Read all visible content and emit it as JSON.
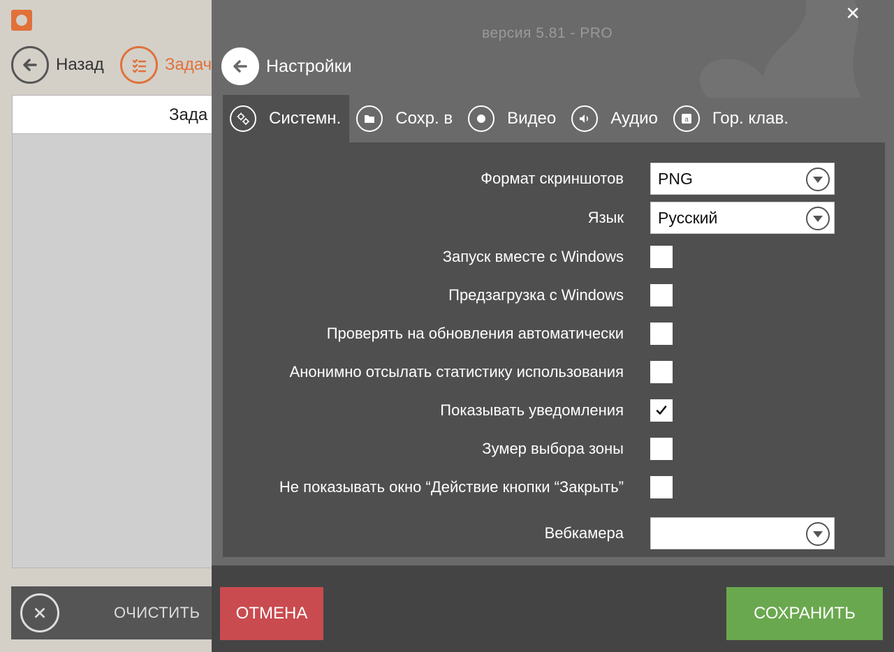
{
  "background_window": {
    "back_label": "Назад",
    "tasks_label": "Задач",
    "table_header": "Зада",
    "clear_label": "ОЧИСТИТЬ"
  },
  "panel": {
    "version": "версия 5.81 - PRO",
    "close_glyph": "✕",
    "title": "Настройки",
    "tabs": [
      {
        "label": "Системн.",
        "icon": "gears-icon",
        "active": true
      },
      {
        "label": "Сохр. в",
        "icon": "folder-icon",
        "active": false
      },
      {
        "label": "Видео",
        "icon": "record-icon",
        "active": false
      },
      {
        "label": "Аудио",
        "icon": "speaker-icon",
        "active": false
      },
      {
        "label": "Гор. клав.",
        "icon": "hotkey-icon",
        "active": false
      }
    ],
    "settings": {
      "screenshot_format": {
        "label": "Формат скриншотов",
        "value": "PNG"
      },
      "language": {
        "label": "Язык",
        "value": "Русский"
      },
      "start_with_windows": {
        "label": "Запуск вместе с Windows",
        "checked": false
      },
      "preload_with_windows": {
        "label": "Предзагрузка с Windows",
        "checked": false
      },
      "auto_update": {
        "label": "Проверять на обновления автоматически",
        "checked": false
      },
      "anonymous_stats": {
        "label": "Анонимно отсылать статистику использования",
        "checked": false
      },
      "show_notifications": {
        "label": "Показывать уведомления",
        "checked": true
      },
      "zone_zoomer": {
        "label": "Зумер выбора зоны",
        "checked": false
      },
      "hide_close_dialog": {
        "label": "Не показывать окно “Действие кнопки “Закрыть”",
        "checked": false
      },
      "webcam": {
        "label": "Вебкамера",
        "value": ""
      }
    },
    "buttons": {
      "cancel": "ОТМЕНА",
      "save": "СОХРАНИТЬ"
    }
  },
  "colors": {
    "accent_orange": "#e0713a",
    "cancel_red": "#c94b4f",
    "save_green": "#6aa84f",
    "panel_bg": "#6a6a6a",
    "content_bg": "#4f4f4f"
  }
}
